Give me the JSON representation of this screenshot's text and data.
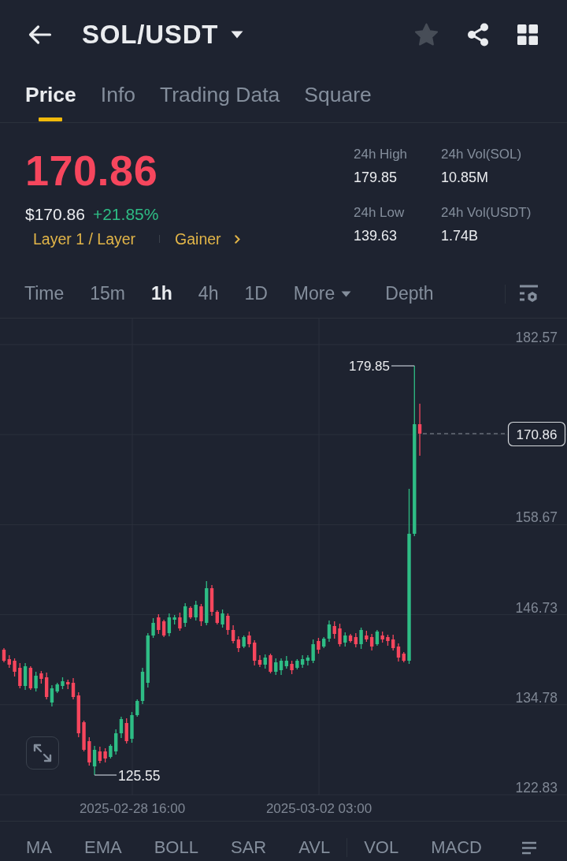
{
  "header": {
    "title": "SOL/USDT",
    "favorited": false
  },
  "tabs": [
    {
      "label": "Price",
      "selected": true
    },
    {
      "label": "Info",
      "selected": false
    },
    {
      "label": "Trading Data",
      "selected": false
    },
    {
      "label": "Square",
      "selected": false
    }
  ],
  "price": {
    "last": "170.86",
    "last_rising": false,
    "fiat": "$170.86",
    "change": "+21.85%",
    "change_positive": true,
    "sector": "Layer 1 / Layer",
    "ranking": "Gainer"
  },
  "stats": [
    {
      "label": "24h High",
      "value": "179.85"
    },
    {
      "label": "24h Vol(SOL)",
      "value": "10.85M"
    },
    {
      "label": "24h Low",
      "value": "139.63"
    },
    {
      "label": "24h Vol(USDT)",
      "value": "1.74B"
    }
  ],
  "intervals": [
    {
      "label": "Time",
      "kind": "interval",
      "selected": false
    },
    {
      "label": "15m",
      "kind": "interval",
      "selected": false
    },
    {
      "label": "1h",
      "kind": "interval",
      "selected": true
    },
    {
      "label": "4h",
      "kind": "interval",
      "selected": false
    },
    {
      "label": "1D",
      "kind": "interval",
      "selected": false
    },
    {
      "label": "More",
      "kind": "menu",
      "selected": false
    },
    {
      "label": "Depth",
      "kind": "view",
      "selected": false
    }
  ],
  "chart": {
    "price_axis": [
      "182.57",
      "158.67",
      "146.73",
      "134.78",
      "122.83"
    ],
    "time_axis": [
      "2025-02-28 16:00",
      "2025-03-02 03:00"
    ],
    "high_label": "179.85",
    "low_label": "125.55",
    "last_price_tag": "170.86"
  },
  "indicators": {
    "main": [
      "MA",
      "EMA",
      "BOLL",
      "SAR",
      "AVL"
    ],
    "sub": [
      "VOL",
      "MACD"
    ]
  }
}
